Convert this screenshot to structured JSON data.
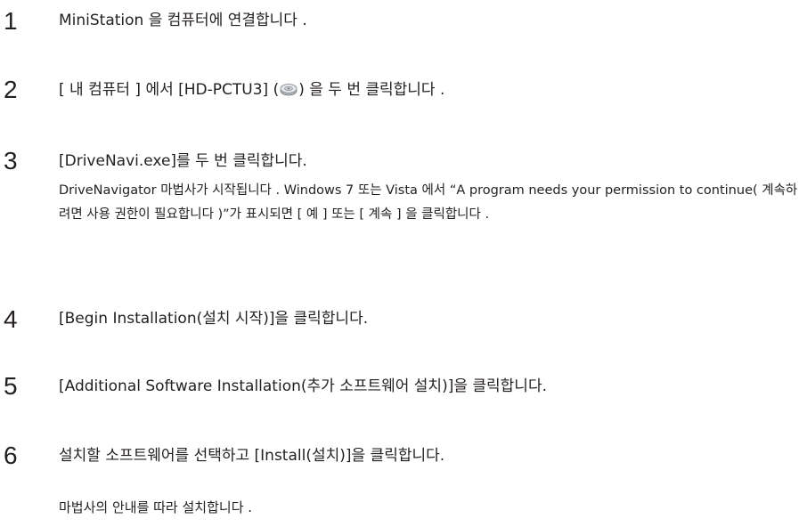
{
  "steps": [
    {
      "number": "1",
      "text": "MiniStation 을 컴퓨터에 연결합니다 ."
    },
    {
      "number": "2",
      "text_before": "[ 내 컴퓨터 ] 에서 [HD-PCTU3] (",
      "icon": "drive-icon",
      "text_after": ") 을 두 번 클릭합니다 ."
    },
    {
      "number": "3",
      "text": "[DriveNavi.exe]를 두 번 클릭합니다.",
      "sub": "DriveNavigator 마법사가 시작됩니다 . Windows 7 또는 Vista 에서 “A program needs your permission to continue( 계속하려면 사용 권한이 필요합니다 )”가 표시되면 [ 예 ] 또는 [ 계속 ] 을 클릭합니다 ."
    },
    {
      "number": "4",
      "text": "[Begin Installation(설치 시작)]을 클릭합니다."
    },
    {
      "number": "5",
      "text": "[Additional Software Installation(추가 소프트웨어 설치)]을 클릭합니다."
    },
    {
      "number": "6",
      "text": "설치할 소프트웨어를 선택하고 [Install(설치)]을 클릭합니다."
    }
  ],
  "closing_note": "마법사의 안내를 따라 설치합니다 ."
}
